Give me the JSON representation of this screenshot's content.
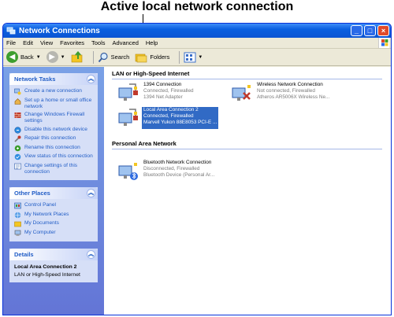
{
  "caption": "Active local network connection",
  "window": {
    "title": "Network Connections"
  },
  "menu": [
    "File",
    "Edit",
    "View",
    "Favorites",
    "Tools",
    "Advanced",
    "Help"
  ],
  "toolbar": {
    "back": "Back",
    "search": "Search",
    "folders": "Folders"
  },
  "tasks": {
    "title": "Network Tasks",
    "items": [
      "Create a new connection",
      "Set up a home or small office network",
      "Change Windows Firewall settings",
      "Disable this network device",
      "Repair this connection",
      "Rename this connection",
      "View status of this connection",
      "Change settings of this connection"
    ]
  },
  "other_places": {
    "title": "Other Places",
    "items": [
      "Control Panel",
      "My Network Places",
      "My Documents",
      "My Computer"
    ]
  },
  "details": {
    "title": "Details",
    "name": "Local Area Connection 2",
    "type": "LAN or High-Speed Internet"
  },
  "groups": {
    "lan": "LAN or High-Speed Internet",
    "pan": "Personal Area Network"
  },
  "connections": {
    "c1394": {
      "name": "1394 Connection",
      "status": "Connected, Firewalled",
      "device": "1394 Net Adapter"
    },
    "wireless": {
      "name": "Wireless Network Connection",
      "status": "Not connected, Firewalled",
      "device": "Atheros AR5006X Wireless Ne..."
    },
    "lan2": {
      "name": "Local Area Connection 2",
      "status": "Connected, Firewalled",
      "device": "Marvell Yukon 88E8053 PCI-E ..."
    },
    "bluetooth": {
      "name": "Bluetooth Network Connection",
      "status": "Disconnected, Firewalled",
      "device": "Bluetooth Device (Personal Ar..."
    }
  }
}
